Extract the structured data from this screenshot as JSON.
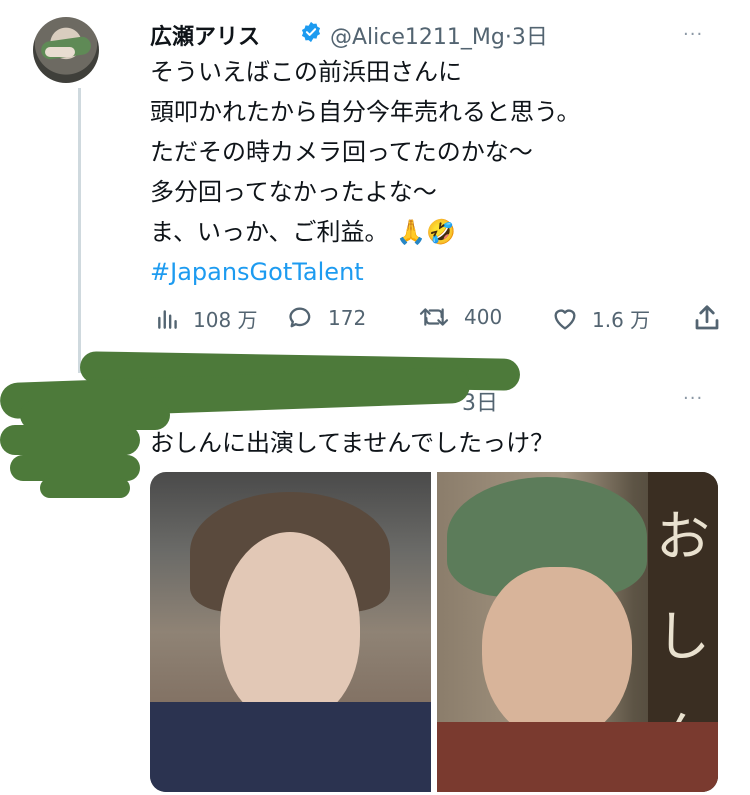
{
  "tweet": {
    "display_name": "広瀬アリス",
    "handle": "@Alice1211_Mg",
    "separator": "·",
    "time": "3日",
    "lines": [
      "そういえばこの前浜田さんに",
      "頭叩かれたから自分今年売れると思う。",
      "ただその時カメラ回ってたのかな〜",
      "多分回ってなかったよな〜",
      "ま、いっか、ご利益。"
    ],
    "emojis": [
      "🙏",
      "🤣"
    ],
    "hashtag": "#JapansGotTalent",
    "more": "···",
    "stats": {
      "views": "108 万",
      "replies": "172",
      "retweets": "400",
      "likes": "1.6 万"
    }
  },
  "reply": {
    "time": "3日",
    "text": "おしんに出演してませんでしたっけ？",
    "more": "···",
    "media_sign_chars": [
      "お",
      "し",
      "ん"
    ]
  },
  "colors": {
    "accent": "#1d9bf0",
    "secondary_text": "#536471",
    "redaction": "#4d7a3a"
  },
  "icons": [
    "verified-badge-icon",
    "views-icon",
    "reply-icon",
    "retweet-icon",
    "like-icon",
    "share-icon",
    "more-icon"
  ]
}
